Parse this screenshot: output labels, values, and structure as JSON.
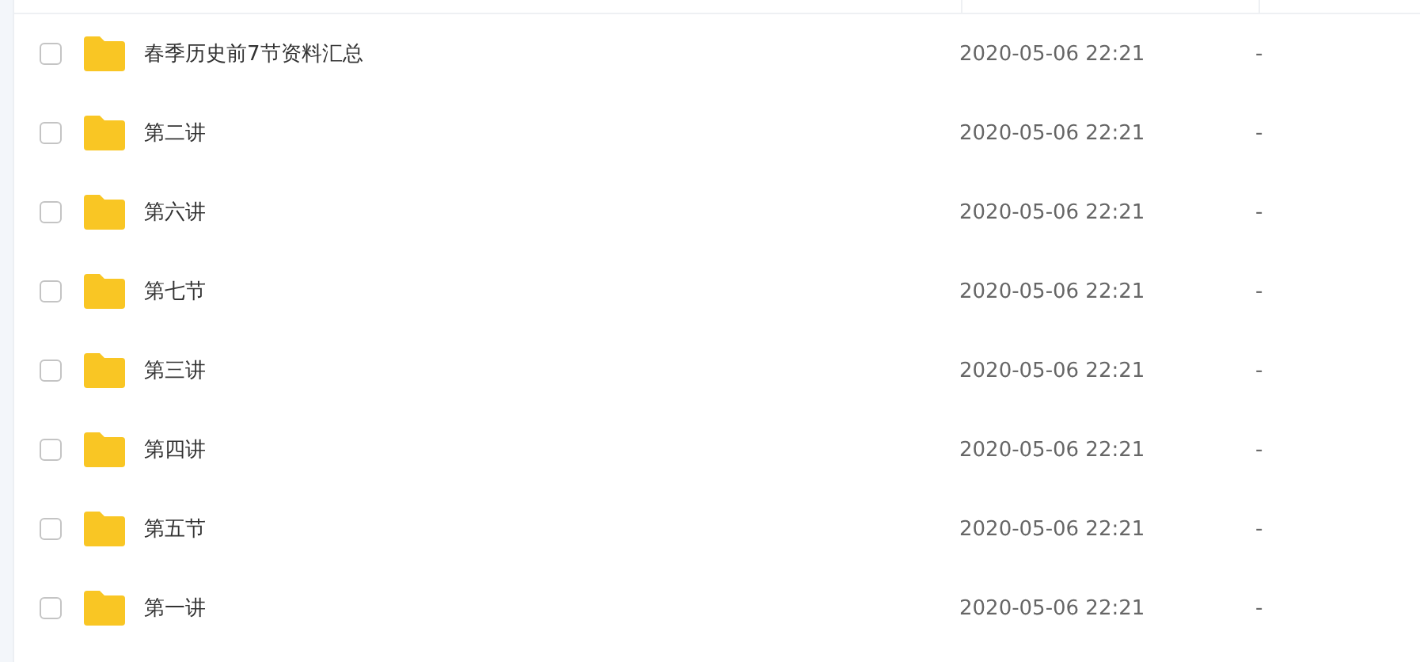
{
  "files": [
    {
      "name": "春季历史前7节资料汇总",
      "modified": "2020-05-06 22:21",
      "size": "-",
      "checked": false
    },
    {
      "name": "第二讲",
      "modified": "2020-05-06 22:21",
      "size": "-",
      "checked": false
    },
    {
      "name": "第六讲",
      "modified": "2020-05-06 22:21",
      "size": "-",
      "checked": false
    },
    {
      "name": "第七节",
      "modified": "2020-05-06 22:21",
      "size": "-",
      "checked": false
    },
    {
      "name": "第三讲",
      "modified": "2020-05-06 22:21",
      "size": "-",
      "checked": false
    },
    {
      "name": "第四讲",
      "modified": "2020-05-06 22:21",
      "size": "-",
      "checked": false
    },
    {
      "name": "第五节",
      "modified": "2020-05-06 22:21",
      "size": "-",
      "checked": false
    },
    {
      "name": "第一讲",
      "modified": "2020-05-06 22:21",
      "size": "-",
      "checked": false
    }
  ]
}
